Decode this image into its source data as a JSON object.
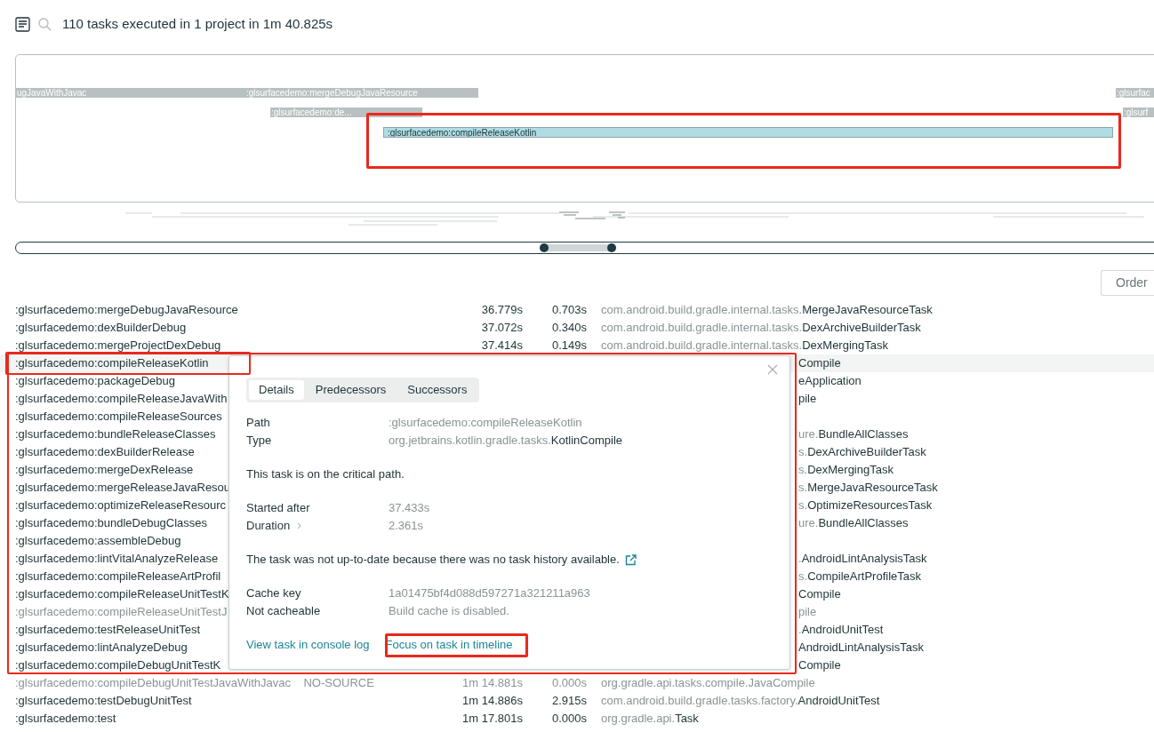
{
  "header": {
    "summary": "110 tasks executed in 1 project in 1m 40.825s"
  },
  "timeline": {
    "bars": [
      {
        "label": "ugJavaWithJavac",
        "selected": false
      },
      {
        "label": ":glsurfacedemo:mergeDebugJavaResource",
        "selected": false
      },
      {
        "label": ":glsurfacedemo:de...",
        "selected": false
      },
      {
        "label": ":glsurfacedemo:compileReleaseKotlin",
        "selected": true
      },
      {
        "label": ":glsurfac",
        "selected": false
      },
      {
        "label": ":glsurf",
        "selected": false
      }
    ]
  },
  "order_button": "Order",
  "table": {
    "rows": [
      {
        "name": ":glsurfacedemo:mergeDebugJavaResource",
        "started": "36.779s",
        "duration": "0.703s",
        "type_prefix": "com.android.build.gradle.internal.tasks.",
        "type_class": "MergeJavaResourceTask",
        "muted": false,
        "selected": false,
        "covered": false
      },
      {
        "name": ":glsurfacedemo:dexBuilderDebug",
        "started": "37.072s",
        "duration": "0.340s",
        "type_prefix": "com.android.build.gradle.internal.tasks.",
        "type_class": "DexArchiveBuilderTask",
        "muted": false,
        "selected": false,
        "covered": false
      },
      {
        "name": ":glsurfacedemo:mergeProjectDexDebug",
        "started": "37.414s",
        "duration": "0.149s",
        "type_prefix": "com.android.build.gradle.internal.tasks.",
        "type_class": "DexMergingTask",
        "muted": false,
        "selected": false,
        "covered": false
      },
      {
        "name": ":glsurfacedemo:compileReleaseKotlin",
        "type_class": "Compile",
        "muted": false,
        "selected": true,
        "covered": true
      },
      {
        "name": ":glsurfacedemo:packageDebug",
        "type_class": "eApplication",
        "muted": false,
        "selected": false,
        "covered": true
      },
      {
        "name": ":glsurfacedemo:compileReleaseJavaWith",
        "type_class": "pile",
        "muted": false,
        "selected": false,
        "covered": true
      },
      {
        "name": ":glsurfacedemo:compileReleaseSources",
        "muted": false,
        "selected": false
      },
      {
        "name": ":glsurfacedemo:bundleReleaseClasses",
        "type_prefix": "ure.",
        "type_class": "BundleAllClasses",
        "muted": false,
        "selected": false,
        "covered": true
      },
      {
        "name": ":glsurfacedemo:dexBuilderRelease",
        "type_prefix": "s.",
        "type_class": "DexArchiveBuilderTask",
        "muted": false,
        "selected": false,
        "covered": true
      },
      {
        "name": ":glsurfacedemo:mergeDexRelease",
        "type_prefix": "s.",
        "type_class": "DexMergingTask",
        "muted": false,
        "selected": false,
        "covered": true
      },
      {
        "name": ":glsurfacedemo:mergeReleaseJavaResou",
        "type_prefix": "s.",
        "type_class": "MergeJavaResourceTask",
        "muted": false,
        "selected": false,
        "covered": true
      },
      {
        "name": ":glsurfacedemo:optimizeReleaseResourc",
        "type_prefix": "s.",
        "type_class": "OptimizeResourcesTask",
        "muted": false,
        "selected": false,
        "covered": true
      },
      {
        "name": ":glsurfacedemo:bundleDebugClasses",
        "type_prefix": "ure.",
        "type_class": "BundleAllClasses",
        "muted": false,
        "selected": false,
        "covered": true
      },
      {
        "name": ":glsurfacedemo:assembleDebug",
        "muted": false,
        "selected": false
      },
      {
        "name": ":glsurfacedemo:lintVitalAnalyzeRelease",
        "type_prefix": ".",
        "type_class": "AndroidLintAnalysisTask",
        "muted": false,
        "selected": false,
        "covered": true
      },
      {
        "name": ":glsurfacedemo:compileReleaseArtProfil",
        "type_prefix": "s.",
        "type_class": "CompileArtProfileTask",
        "muted": false,
        "selected": false,
        "covered": true
      },
      {
        "name": ":glsurfacedemo:compileReleaseUnitTestK",
        "type_class": "Compile",
        "muted": false,
        "selected": false,
        "covered": true
      },
      {
        "name": ":glsurfacedemo:compileReleaseUnitTestJ",
        "type_class": "pile",
        "muted": true,
        "selected": false,
        "covered": true
      },
      {
        "name": ":glsurfacedemo:testReleaseUnitTest",
        "type_prefix": ".",
        "type_class": "AndroidUnitTest",
        "muted": false,
        "selected": false,
        "covered": true
      },
      {
        "name": ":glsurfacedemo:lintAnalyzeDebug",
        "type_class": "AndroidLintAnalysisTask",
        "muted": false,
        "selected": false,
        "covered": true
      },
      {
        "name": ":glsurfacedemo:compileDebugUnitTestK",
        "type_class": "Compile",
        "muted": false,
        "selected": false,
        "covered": true
      },
      {
        "name": ":glsurfacedemo:compileDebugUnitTestJavaWithJavac    NO-SOURCE",
        "started": "1m 14.881s",
        "duration": "0.000s",
        "type_prefix": "org.gradle.api.tasks.compile.",
        "type_class": "JavaCompile",
        "muted": true,
        "selected": false,
        "covered": false
      },
      {
        "name": ":glsurfacedemo:testDebugUnitTest",
        "started": "1m 14.886s",
        "duration": "2.915s",
        "type_prefix": "com.android.build.gradle.tasks.factory.",
        "type_class": "AndroidUnitTest",
        "muted": false,
        "selected": false,
        "covered": false
      },
      {
        "name": ":glsurfacedemo:test",
        "started": "1m 17.801s",
        "duration": "0.000s",
        "type_prefix": "org.gradle.api.",
        "type_class": "Task",
        "muted": false,
        "selected": false,
        "covered": false
      }
    ]
  },
  "popover": {
    "tabs": [
      {
        "label": "Details",
        "selected": true
      },
      {
        "label": "Predecessors",
        "selected": false
      },
      {
        "label": "Successors",
        "selected": false
      }
    ],
    "path_label": "Path",
    "path": ":glsurfacedemo:compileReleaseKotlin",
    "type_label": "Type",
    "type_prefix": "org.jetbrains.kotlin.gradle.tasks.",
    "type_class": "KotlinCompile",
    "critical_note": "This task is on the critical path.",
    "started_label": "Started after",
    "started": "37.433s",
    "duration_label": "Duration",
    "duration": "2.361s",
    "reason": "The task was not up-to-date because there was no task history available.",
    "cache_key_label": "Cache key",
    "cache_key": "1a01475bf4d088d597271a321211a963",
    "cacheable_label": "Not cacheable",
    "cacheable": "Build cache is disabled.",
    "links": [
      "View task in console log",
      "Focus on task in timeline"
    ]
  }
}
